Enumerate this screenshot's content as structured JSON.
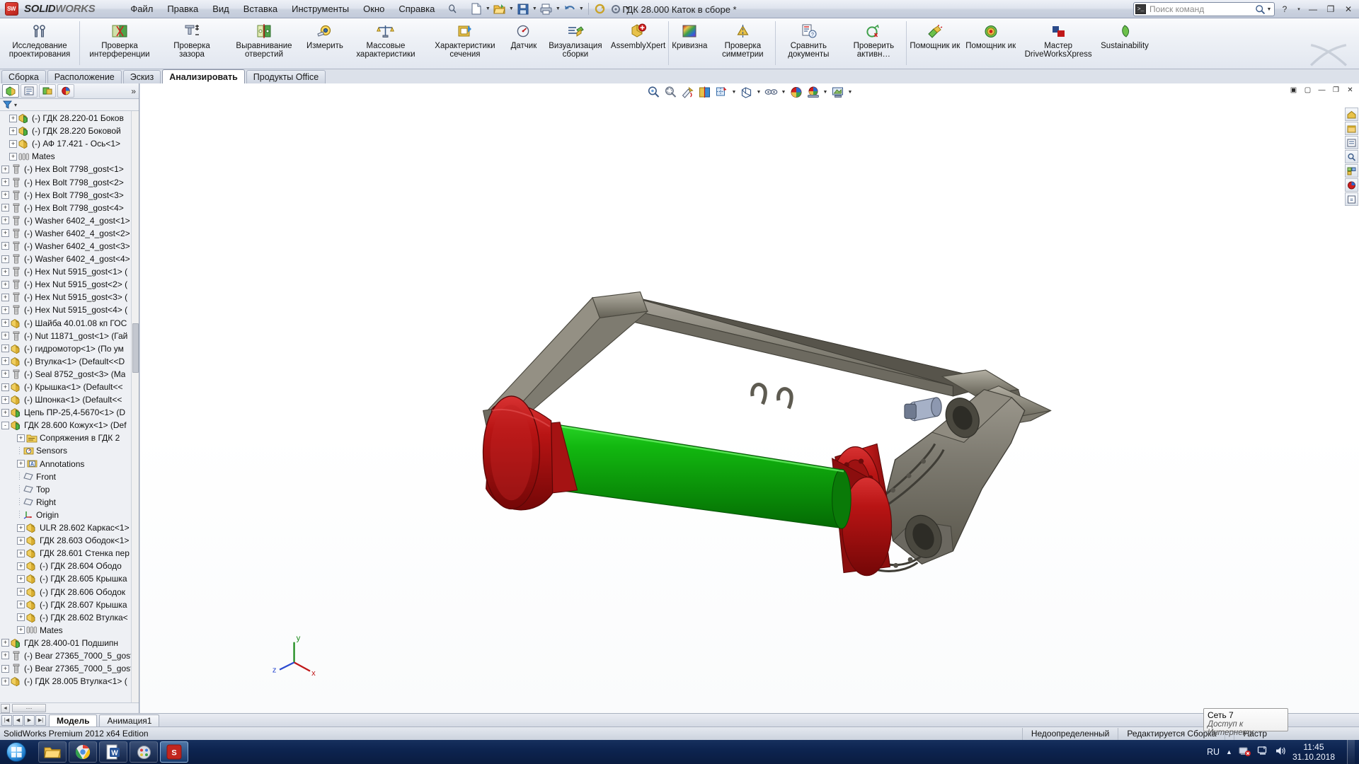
{
  "app": {
    "brand_solid": "SOLID",
    "brand_works": "WORKS",
    "logo_text": "SW",
    "title": "ГДК 28.000 Каток в сборе *",
    "edition": "SolidWorks Premium 2012 x64 Edition"
  },
  "menu": {
    "items": [
      {
        "label": "Файл"
      },
      {
        "label": "Правка"
      },
      {
        "label": "Вид"
      },
      {
        "label": "Вставка"
      },
      {
        "label": "Инструменты"
      },
      {
        "label": "Окно"
      },
      {
        "label": "Справка"
      }
    ],
    "pin_icon": "pin-icon"
  },
  "quick_access": {
    "buttons": [
      {
        "name": "new-document-icon",
        "has_arrow": true
      },
      {
        "name": "open-document-icon",
        "has_arrow": true
      },
      {
        "name": "save-document-icon",
        "has_arrow": true
      },
      {
        "name": "print-icon",
        "has_arrow": true
      },
      {
        "name": "undo-icon",
        "has_arrow": true
      },
      {
        "name": "rebuild-icon",
        "has_arrow": false
      },
      {
        "name": "options-icon",
        "has_arrow": true
      }
    ]
  },
  "search": {
    "placeholder": "Поиск команд",
    "icon": "command-search-icon",
    "magnifier": "magnifier-icon"
  },
  "window_controls": {
    "help": "?",
    "help_arrow": "▾",
    "minimize": "—",
    "restore": "❐",
    "close": "✕"
  },
  "ribbon": {
    "groups": [
      {
        "buttons": [
          {
            "label": "Исследование проектирования",
            "icon": "design-study-icon",
            "wide": true
          }
        ]
      },
      {
        "buttons": [
          {
            "label": "Проверка интерференции",
            "icon": "interference-check-icon",
            "wide": true
          },
          {
            "label": "Проверка зазора",
            "icon": "clearance-check-icon"
          },
          {
            "label": "Выравнивание отверстий",
            "icon": "hole-alignment-icon",
            "wide": true
          },
          {
            "label": "Измерить",
            "icon": "measure-icon"
          },
          {
            "label": "Массовые характеристики",
            "icon": "mass-properties-icon",
            "wide": true
          },
          {
            "label": "Характеристики сечения",
            "icon": "section-properties-icon",
            "wide": true
          },
          {
            "label": "Датчик",
            "icon": "sensor-icon"
          },
          {
            "label": "Визуализация сборки",
            "icon": "assembly-visualization-icon"
          },
          {
            "label": "AssemblyXpert",
            "icon": "assemblyxpert-icon",
            "wide": true
          }
        ]
      },
      {
        "buttons": [
          {
            "label": "Кривизна",
            "icon": "curvature-icon"
          },
          {
            "label": "Проверка симметрии",
            "icon": "symmetry-check-icon"
          }
        ]
      },
      {
        "buttons": [
          {
            "label": "Сравнить документы",
            "icon": "compare-documents-icon"
          },
          {
            "label": "Проверить активн…",
            "icon": "check-active-icon"
          }
        ]
      },
      {
        "buttons": [
          {
            "label": "Помощник ик",
            "icon": "simulation-assistant-icon"
          },
          {
            "label": "Помощник ик",
            "icon": "floxpress-assistant-icon"
          },
          {
            "label": "Мастер DriveWorksXpress",
            "icon": "driveworksxpress-icon",
            "wide": true
          },
          {
            "label": "Sustainability",
            "icon": "sustainability-icon",
            "wide": true
          }
        ]
      }
    ]
  },
  "command_tabs": [
    {
      "label": "Сборка",
      "active": false
    },
    {
      "label": "Расположение",
      "active": false
    },
    {
      "label": "Эскиз",
      "active": false
    },
    {
      "label": "Анализировать",
      "active": true
    },
    {
      "label": "Продукты Office",
      "active": false
    }
  ],
  "left_panel": {
    "tabs": [
      {
        "name": "feature-manager-tab",
        "icon": "feature-tree-icon",
        "active": true
      },
      {
        "name": "property-manager-tab",
        "icon": "property-manager-icon",
        "active": false
      },
      {
        "name": "configuration-manager-tab",
        "icon": "configuration-icon",
        "active": false
      },
      {
        "name": "display-manager-tab",
        "icon": "display-manager-icon",
        "active": false
      }
    ],
    "more": "»",
    "filter_icon": "filter-icon",
    "filter_arrow": "▾",
    "scroll_left_icon": "◄",
    "scroll_thumb": "⋯",
    "tree": [
      {
        "indent": 1,
        "expand": "+",
        "icon": "part-green",
        "label": "(-) ГДК 28.220-01 Боков"
      },
      {
        "indent": 1,
        "expand": "+",
        "icon": "part-green",
        "label": "(-) ГДК 28.220 Боковой"
      },
      {
        "indent": 1,
        "expand": "+",
        "icon": "part-yellow",
        "label": "(-) АФ 17.421 - Ось<1>"
      },
      {
        "indent": 1,
        "expand": "+",
        "icon": "mates",
        "label": "Mates"
      },
      {
        "indent": 0,
        "expand": "+",
        "icon": "bolt",
        "label": "(-) Hex Bolt 7798_gost<1>"
      },
      {
        "indent": 0,
        "expand": "+",
        "icon": "bolt",
        "label": "(-) Hex Bolt 7798_gost<2>"
      },
      {
        "indent": 0,
        "expand": "+",
        "icon": "bolt",
        "label": "(-) Hex Bolt 7798_gost<3>"
      },
      {
        "indent": 0,
        "expand": "+",
        "icon": "bolt",
        "label": "(-) Hex Bolt 7798_gost<4>"
      },
      {
        "indent": 0,
        "expand": "+",
        "icon": "bolt",
        "label": "(-) Washer 6402_4_gost<1>"
      },
      {
        "indent": 0,
        "expand": "+",
        "icon": "bolt",
        "label": "(-) Washer 6402_4_gost<2>"
      },
      {
        "indent": 0,
        "expand": "+",
        "icon": "bolt",
        "label": "(-) Washer 6402_4_gost<3>"
      },
      {
        "indent": 0,
        "expand": "+",
        "icon": "bolt",
        "label": "(-) Washer 6402_4_gost<4>"
      },
      {
        "indent": 0,
        "expand": "+",
        "icon": "bolt",
        "label": "(-) Hex Nut 5915_gost<1> ("
      },
      {
        "indent": 0,
        "expand": "+",
        "icon": "bolt",
        "label": "(-) Hex Nut 5915_gost<2> ("
      },
      {
        "indent": 0,
        "expand": "+",
        "icon": "bolt",
        "label": "(-) Hex Nut 5915_gost<3> ("
      },
      {
        "indent": 0,
        "expand": "+",
        "icon": "bolt",
        "label": "(-) Hex Nut 5915_gost<4> ("
      },
      {
        "indent": 0,
        "expand": "+",
        "icon": "part-yellow",
        "label": "(-) Шайба 40.01.08 кп ГОС"
      },
      {
        "indent": 0,
        "expand": "+",
        "icon": "bolt",
        "label": "(-) Nut 11871_gost<1> (Гай"
      },
      {
        "indent": 0,
        "expand": "+",
        "icon": "part-yellow",
        "label": "(-) гидромотор<1> (По ум"
      },
      {
        "indent": 0,
        "expand": "+",
        "icon": "part-yellow",
        "label": "(-) Втулка<1> (Default<<D"
      },
      {
        "indent": 0,
        "expand": "+",
        "icon": "bolt",
        "label": "(-) Seal 8752_gost<3> (Ma"
      },
      {
        "indent": 0,
        "expand": "+",
        "icon": "part-yellow",
        "label": "(-) Крышка<1> (Default<<"
      },
      {
        "indent": 0,
        "expand": "+",
        "icon": "part-yellow",
        "label": "(-) Шпонка<1> (Default<<"
      },
      {
        "indent": 0,
        "expand": "+",
        "icon": "part-green",
        "label": "Цепь ПР-25,4-5670<1> (D"
      },
      {
        "indent": 0,
        "expand": "-",
        "icon": "part-green",
        "label": "ГДК 28.600 Кожух<1> (Def"
      },
      {
        "indent": 2,
        "expand": "+",
        "icon": "mates-folder",
        "label": "Сопряжения в ГДК 2"
      },
      {
        "indent": 2,
        "expand": "",
        "icon": "sensors",
        "label": "Sensors"
      },
      {
        "indent": 2,
        "expand": "+",
        "icon": "annotations",
        "label": "Annotations"
      },
      {
        "indent": 2,
        "expand": "",
        "icon": "plane",
        "label": "Front"
      },
      {
        "indent": 2,
        "expand": "",
        "icon": "plane",
        "label": "Top"
      },
      {
        "indent": 2,
        "expand": "",
        "icon": "plane",
        "label": "Right"
      },
      {
        "indent": 2,
        "expand": "",
        "icon": "origin",
        "label": "Origin"
      },
      {
        "indent": 2,
        "expand": "+",
        "icon": "part-yellow",
        "label": "ULR 28.602 Каркас<1>"
      },
      {
        "indent": 2,
        "expand": "+",
        "icon": "part-yellow",
        "label": "ГДК 28.603 Ободок<1>"
      },
      {
        "indent": 2,
        "expand": "+",
        "icon": "part-yellow",
        "label": "ГДК 28.601 Стенка пер"
      },
      {
        "indent": 2,
        "expand": "+",
        "icon": "part-yellow",
        "label": "(-) ГДК 28.604 Ободо"
      },
      {
        "indent": 2,
        "expand": "+",
        "icon": "part-yellow",
        "label": "(-) ГДК 28.605 Крышка"
      },
      {
        "indent": 2,
        "expand": "+",
        "icon": "part-yellow",
        "label": "(-) ГДК 28.606 Ободок"
      },
      {
        "indent": 2,
        "expand": "+",
        "icon": "part-yellow",
        "label": "(-) ГДК 28.607 Крышка"
      },
      {
        "indent": 2,
        "expand": "+",
        "icon": "part-yellow",
        "label": "(-) ГДК 28.602 Втулка<"
      },
      {
        "indent": 2,
        "expand": "+",
        "icon": "mates",
        "label": "Mates"
      },
      {
        "indent": 0,
        "expand": "+",
        "icon": "part-green",
        "label": "ГДК 28.400-01 Подшипн"
      },
      {
        "indent": 0,
        "expand": "+",
        "icon": "bolt",
        "label": "(-) Bear 27365_7000_5_gost"
      },
      {
        "indent": 0,
        "expand": "+",
        "icon": "bolt",
        "label": "(-) Bear 27365_7000_5_gost"
      },
      {
        "indent": 0,
        "expand": "+",
        "icon": "part-yellow",
        "label": "(-) ГДК 28.005 Втулка<1>  ("
      }
    ]
  },
  "view_toolbar": {
    "buttons": [
      {
        "name": "zoom-to-fit-icon",
        "arrow": false
      },
      {
        "name": "zoom-to-area-icon",
        "arrow": false
      },
      {
        "name": "previous-view-icon",
        "arrow": false
      },
      {
        "name": "section-view-icon",
        "arrow": false
      },
      {
        "name": "view-orientation-icon",
        "arrow": true
      },
      {
        "name": "display-style-icon",
        "arrow": true
      },
      {
        "name": "hide-show-items-icon",
        "arrow": true
      },
      {
        "name": "edit-appearance-icon",
        "arrow": false
      },
      {
        "name": "apply-scene-icon",
        "arrow": true
      },
      {
        "name": "view-settings-icon",
        "arrow": true
      }
    ]
  },
  "viewport_window_controls": {
    "buttons": [
      "restore-icon",
      "tile-icon",
      "minimize-icon",
      "maximize-icon",
      "close-icon"
    ]
  },
  "right_dock": {
    "buttons": [
      {
        "name": "home-icon"
      },
      {
        "name": "design-library-icon"
      },
      {
        "name": "file-explorer-icon"
      },
      {
        "name": "search-panel-icon"
      },
      {
        "name": "view-palette-icon"
      },
      {
        "name": "appearances-icon"
      },
      {
        "name": "custom-properties-icon"
      }
    ]
  },
  "triad": {
    "x_label": "x",
    "y_label": "y",
    "z_label": "z"
  },
  "document_tabs": {
    "nav": [
      "first-tab-icon",
      "prev-tab-icon",
      "next-tab-icon",
      "last-tab-icon"
    ],
    "tabs": [
      {
        "label": "Модель",
        "active": true
      },
      {
        "label": "Анимация1",
        "active": false
      }
    ]
  },
  "status_bar": {
    "left": "SolidWorks Premium 2012 x64 Edition",
    "cells": [
      {
        "label": "Недоопределенный"
      },
      {
        "label": "Редактируется Сборка"
      },
      {
        "label": ""
      },
      {
        "label": "Настр"
      }
    ]
  },
  "network_tooltip": {
    "line1": "Сеть 7",
    "line2": "Доступ к Интернету"
  },
  "taskbar": {
    "start": "start-orb-icon",
    "apps": [
      {
        "name": "taskbar-explorer-icon",
        "active": false
      },
      {
        "name": "taskbar-chrome-icon",
        "active": false
      },
      {
        "name": "taskbar-word-icon",
        "active": false
      },
      {
        "name": "taskbar-paint-icon",
        "active": false
      },
      {
        "name": "taskbar-solidworks-icon",
        "active": true
      }
    ],
    "tray": {
      "language": "RU",
      "expand_arrow": "▲",
      "icons": [
        "network-error-icon",
        "action-center-icon",
        "volume-icon"
      ],
      "time": "11:45",
      "date": "31.10.2018"
    }
  }
}
